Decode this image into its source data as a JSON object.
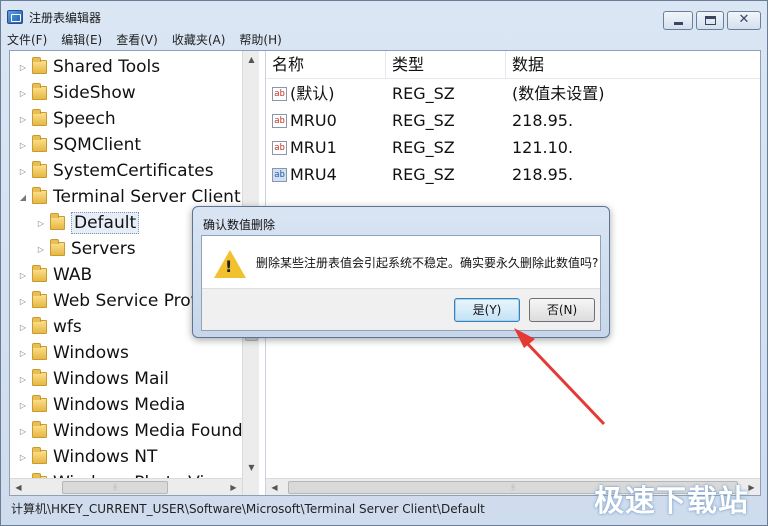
{
  "window": {
    "title": "注册表编辑器",
    "close_glyph": "✕"
  },
  "menubar": [
    "文件(F)",
    "编辑(E)",
    "查看(V)",
    "收藏夹(A)",
    "帮助(H)"
  ],
  "tree": {
    "items": [
      {
        "label": "Shared Tools",
        "level": 1
      },
      {
        "label": "SideShow",
        "level": 1
      },
      {
        "label": "Speech",
        "level": 1
      },
      {
        "label": "SQMClient",
        "level": 1
      },
      {
        "label": "SystemCertificates",
        "level": 1
      },
      {
        "label": "Terminal Server Client",
        "level": 1,
        "expanded": true
      },
      {
        "label": "Default",
        "level": 2,
        "selected": true
      },
      {
        "label": "Servers",
        "level": 2
      },
      {
        "label": "WAB",
        "level": 1
      },
      {
        "label": "Web Service Prov",
        "level": 1
      },
      {
        "label": "wfs",
        "level": 1
      },
      {
        "label": "Windows",
        "level": 1
      },
      {
        "label": "Windows Mail",
        "level": 1
      },
      {
        "label": "Windows Media",
        "level": 1
      },
      {
        "label": "Windows Media Found",
        "level": 1
      },
      {
        "label": "Windows NT",
        "level": 1
      },
      {
        "label": "Windows Photo Vi",
        "level": 1
      }
    ]
  },
  "list": {
    "headers": [
      "名称",
      "类型",
      "数据"
    ],
    "rows": [
      {
        "name": "(默认)",
        "type": "REG_SZ",
        "data": "(数值未设置)",
        "icon": "ab"
      },
      {
        "name": "MRU0",
        "type": "REG_SZ",
        "data": "218.95.",
        "icon": "ab"
      },
      {
        "name": "MRU1",
        "type": "REG_SZ",
        "data": "121.10.",
        "icon": "ab"
      },
      {
        "name": "MRU4",
        "type": "REG_SZ",
        "data": "218.95.",
        "icon": "ab",
        "selected": true
      }
    ]
  },
  "statusbar": {
    "path": "计算机\\HKEY_CURRENT_USER\\Software\\Microsoft\\Terminal Server Client\\Default"
  },
  "dialog": {
    "title": "确认数值删除",
    "message": "删除某些注册表值会引起系统不稳定。确实要永久删除此数值吗?",
    "yes_label": "是(Y)",
    "no_label": "否(N)",
    "warning_mark": "!"
  },
  "annotation": {
    "arrow_color": "#e53935"
  },
  "watermark": "极速下载站"
}
